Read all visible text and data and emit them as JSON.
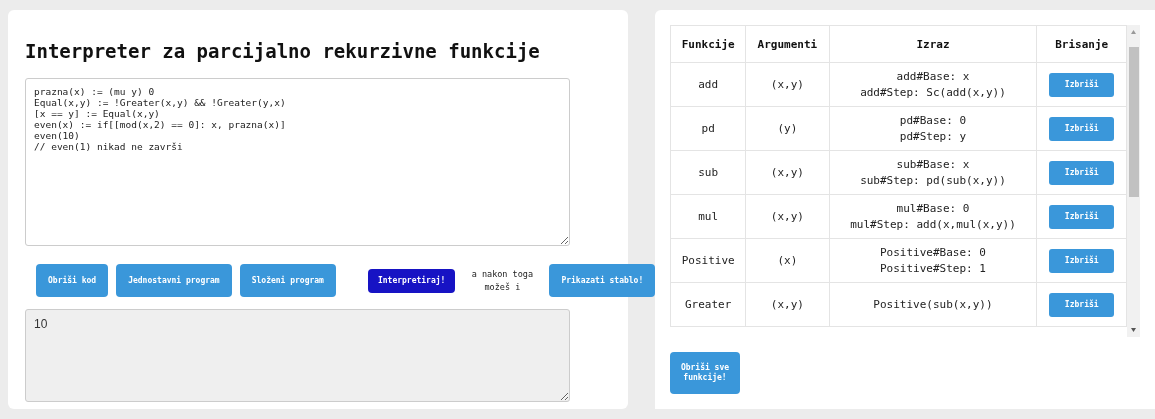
{
  "title": "Interpreter za parcijalno rekurzivne funkcije",
  "code_editor": {
    "value": "prazna(x) := (mu y) 0\nEqual(x,y) := !Greater(x,y) && !Greater(y,x)\n[x == y] := Equal(x,y)\neven(x) := if[[mod(x,2) == 0]: x, prazna(x)]\neven(10)\n// even(1) nikad ne završi"
  },
  "actions": [
    {
      "kind": "button",
      "label": "Obriši kod"
    },
    {
      "kind": "button",
      "label": "Jednostavni program"
    },
    {
      "kind": "button",
      "label": "Složeni program"
    },
    {
      "kind": "primary",
      "label": "Interpretiraj!"
    },
    {
      "kind": "note",
      "label": "a nakon toga možeš i"
    },
    {
      "kind": "button",
      "label": "Prikazati stablo!"
    }
  ],
  "output": {
    "value": "10"
  },
  "table": {
    "columns": [
      "Funkcije",
      "Argumenti",
      "Izraz",
      "Brisanje"
    ],
    "rows": [
      {
        "name": "add",
        "args": "(x,y)",
        "expr": [
          "add#Base: x",
          "add#Step: Sc(add(x,y))"
        ],
        "action": "Izbriši"
      },
      {
        "name": "pd",
        "args": "(y)",
        "expr": [
          "pd#Base: 0",
          "pd#Step: y"
        ],
        "action": "Izbriši"
      },
      {
        "name": "sub",
        "args": "(x,y)",
        "expr": [
          "sub#Base: x",
          "sub#Step: pd(sub(x,y))"
        ],
        "action": "Izbriši"
      },
      {
        "name": "mul",
        "args": "(x,y)",
        "expr": [
          "mul#Base: 0",
          "mul#Step: add(x,mul(x,y))"
        ],
        "action": "Izbriši"
      },
      {
        "name": "Positive",
        "args": "(x)",
        "expr": [
          "Positive#Base: 0",
          "Positive#Step: 1"
        ],
        "action": "Izbriši"
      },
      {
        "name": "Greater",
        "args": "(x,y)",
        "expr": [
          "Positive(sub(x,y))"
        ],
        "action": "Izbriši"
      }
    ]
  },
  "clear_all": "Obriši sve funkcije!"
}
